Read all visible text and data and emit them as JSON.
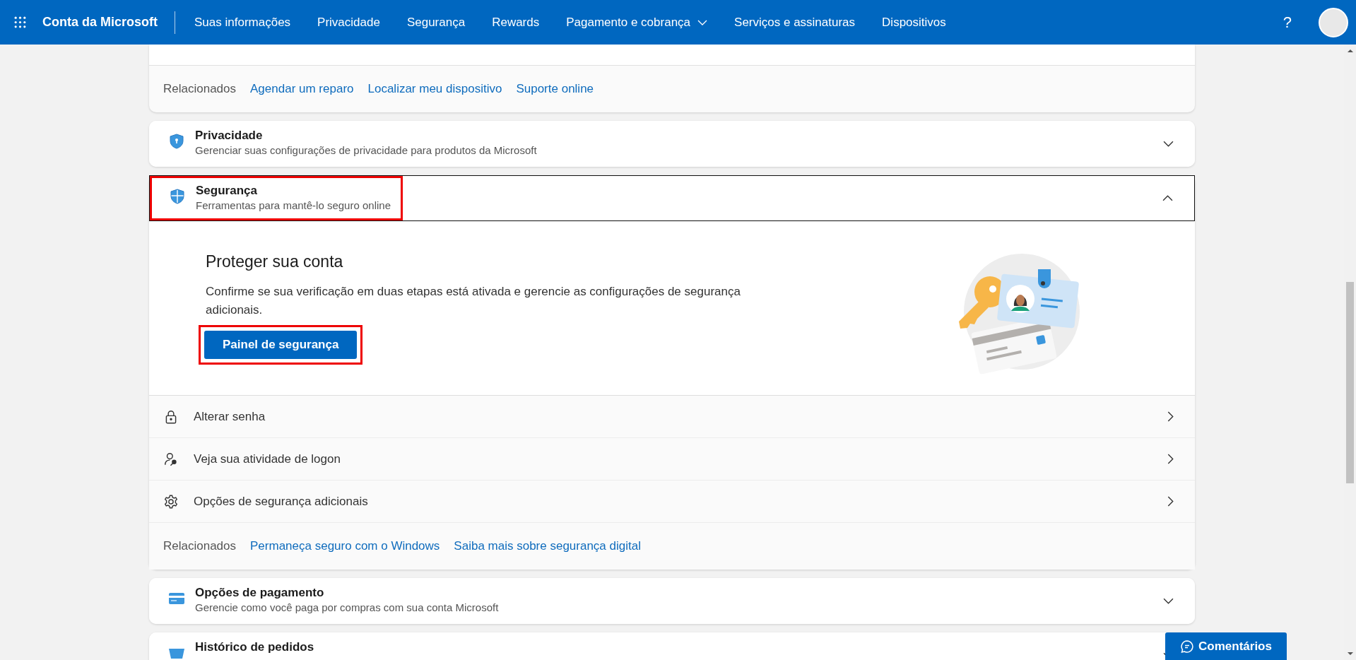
{
  "header": {
    "app_title": "Conta da Microsoft",
    "nav": [
      {
        "label": "Suas informações",
        "has_menu": false
      },
      {
        "label": "Privacidade",
        "has_menu": false
      },
      {
        "label": "Segurança",
        "has_menu": false
      },
      {
        "label": "Rewards",
        "has_menu": false
      },
      {
        "label": "Pagamento e cobrança",
        "has_menu": true
      },
      {
        "label": "Serviços e assinaturas",
        "has_menu": false
      },
      {
        "label": "Dispositivos",
        "has_menu": false
      }
    ],
    "help": "?"
  },
  "top_card": {
    "related_label": "Relacionados",
    "related_links": [
      "Agendar um reparo",
      "Localizar meu dispositivo",
      "Suporte online"
    ]
  },
  "sections": [
    {
      "kind": "privacy",
      "title": "Privacidade",
      "subtitle": "Gerenciar suas configurações de privacidade para produtos da Microsoft",
      "expanded": false,
      "highlighted": false
    },
    {
      "kind": "security",
      "title": "Segurança",
      "subtitle": "Ferramentas para mantê-lo seguro online",
      "expanded": true,
      "highlighted": true,
      "body": {
        "heading": "Proteger sua conta",
        "text": "Confirme se sua verificação em duas etapas está ativada e gerencie as configurações de segurança adicionais.",
        "button": {
          "label": "Painel de segurança",
          "highlighted": true
        },
        "actions": [
          {
            "kind": "password",
            "label": "Alterar senha"
          },
          {
            "kind": "activity",
            "label": "Veja sua atividade de logon"
          },
          {
            "kind": "options",
            "label": "Opções de segurança adicionais"
          }
        ],
        "related_label": "Relacionados",
        "related_links": [
          "Permaneça seguro com o Windows",
          "Saiba mais sobre segurança digital"
        ]
      }
    },
    {
      "kind": "payment",
      "title": "Opções de pagamento",
      "subtitle": "Gerencie como você paga por compras com sua conta Microsoft",
      "expanded": false,
      "highlighted": false
    },
    {
      "kind": "orders",
      "title": "Histórico de pedidos",
      "expanded": false,
      "highlighted": false
    }
  ],
  "feedback_button": "Comentários"
}
